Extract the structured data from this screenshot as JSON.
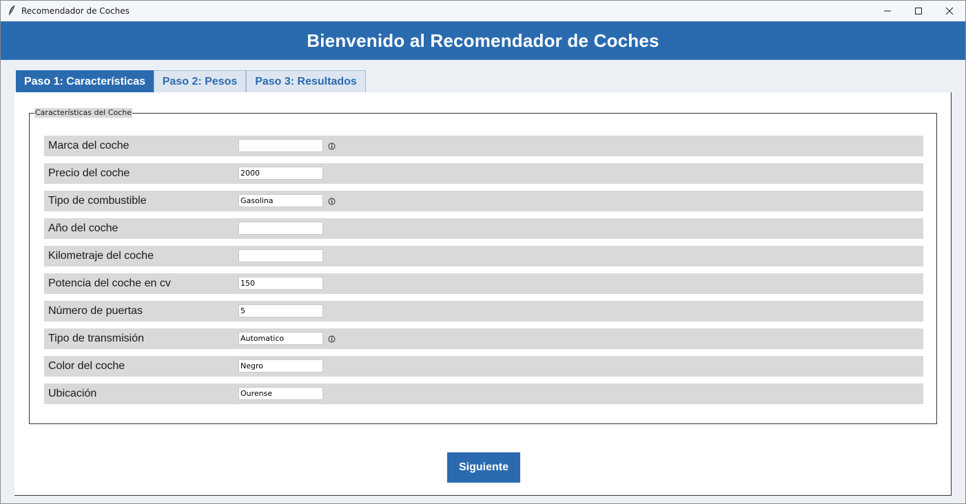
{
  "window": {
    "title": "Recomendador de Coches"
  },
  "header": {
    "title": "Bienvenido al Recomendador de Coches"
  },
  "tabs": [
    {
      "label": "Paso 1: Características",
      "active": true
    },
    {
      "label": "Paso 2: Pesos",
      "active": false
    },
    {
      "label": "Paso 3: Resultados",
      "active": false
    }
  ],
  "form": {
    "group_label": "Características del Coche",
    "fields": [
      {
        "label": "Marca del coche",
        "value": "",
        "info_icon": true
      },
      {
        "label": "Precio del coche",
        "value": "2000",
        "info_icon": false
      },
      {
        "label": "Tipo de combustible",
        "value": "Gasolina",
        "info_icon": true
      },
      {
        "label": "Año del coche",
        "value": "",
        "info_icon": false
      },
      {
        "label": "Kilometraje del coche",
        "value": "",
        "info_icon": false
      },
      {
        "label": "Potencia del coche en cv",
        "value": "150",
        "info_icon": false
      },
      {
        "label": "Número de puertas",
        "value": "5",
        "info_icon": false
      },
      {
        "label": "Tipo de transmisión",
        "value": "Automatico",
        "info_icon": true
      },
      {
        "label": "Color del coche",
        "value": "Negro",
        "info_icon": false
      },
      {
        "label": "Ubicación",
        "value": "Ourense",
        "info_icon": false
      }
    ]
  },
  "actions": {
    "next_label": "Siguiente"
  },
  "colors": {
    "primary": "#2a6bb0",
    "row_bg": "#d9d9d9",
    "window_bg": "#ecf0f5"
  },
  "icons": {
    "app": "feather-icon",
    "info": "info-icon",
    "minimize": "minimize-icon",
    "maximize": "maximize-icon",
    "close": "close-icon"
  }
}
